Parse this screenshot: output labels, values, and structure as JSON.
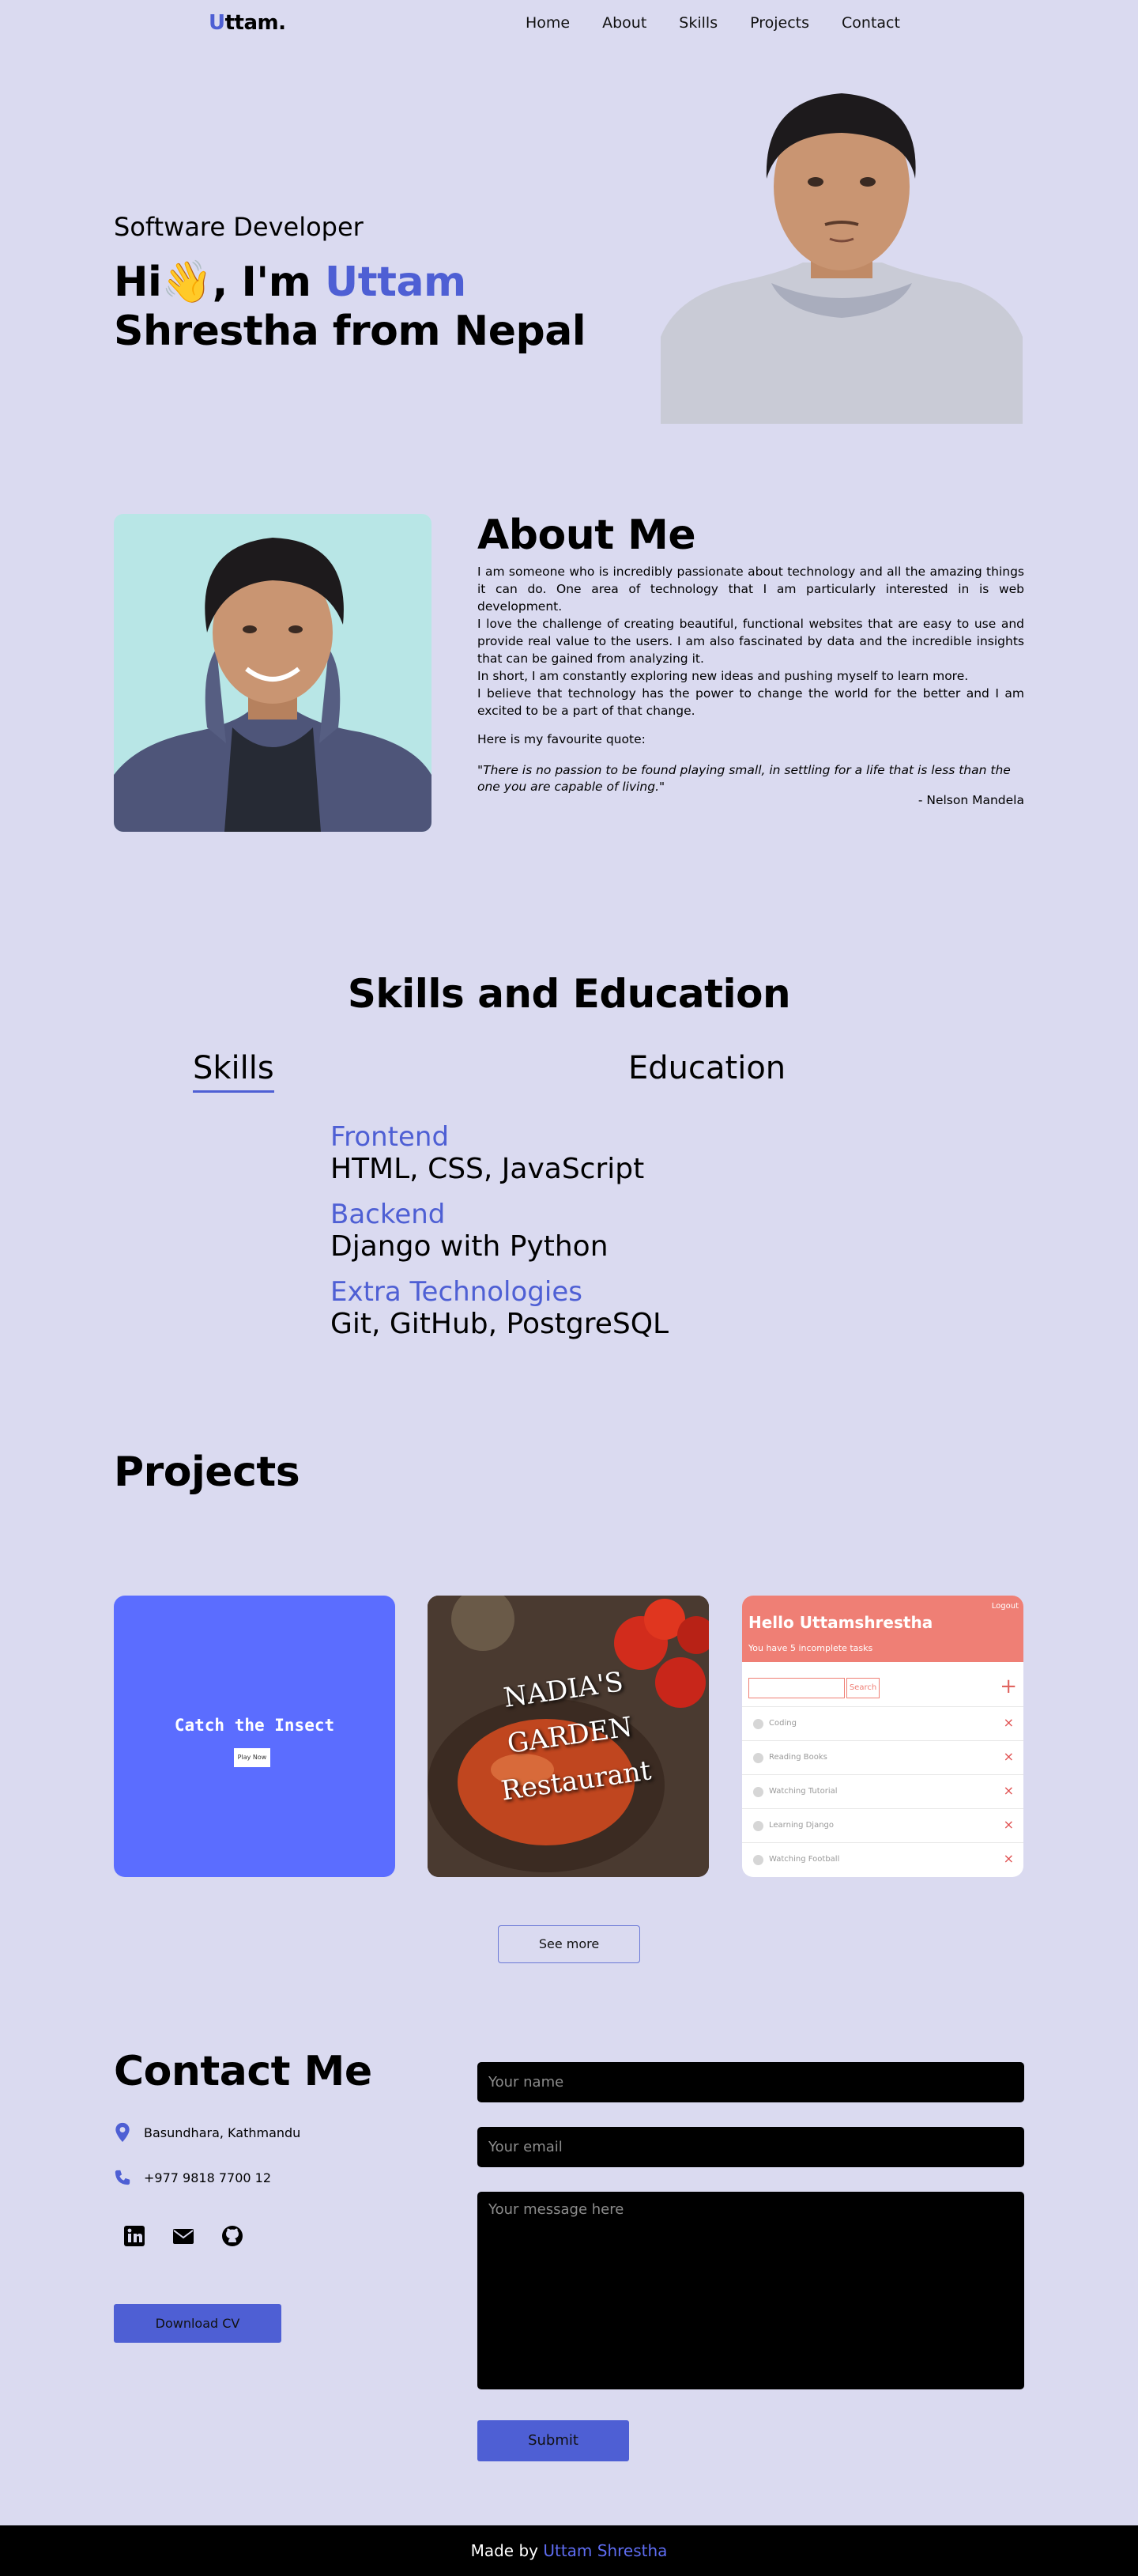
{
  "nav": {
    "brand_first": "U",
    "brand_rest": "ttam.",
    "links": [
      "Home",
      "About",
      "Skills",
      "Projects",
      "Contact"
    ]
  },
  "hero": {
    "subtitle": "Software Developer",
    "title_prefix": "Hi",
    "wave_emoji": "👋",
    "title_mid": ", I'm ",
    "title_name": "Uttam",
    "title_line2": "Shrestha from Nepal"
  },
  "about": {
    "title": "About Me",
    "paragraphs": [
      "I am someone who is incredibly passionate about technology and all the amazing things it can do. One area of technology that I am particularly interested in is web development.",
      "I love the challenge of creating beautiful, functional websites that are easy to use and provide real value to the users. I am also fascinated by data and the incredible insights that can be gained from analyzing it.",
      "In short, I am constantly exploring new ideas and pushing myself to learn more.",
      "I believe that technology has the power to change the world for the better and I am excited to be a part of that change."
    ],
    "quote_intro": "Here is my favourite quote:",
    "quote": "\"There is no passion to be found playing small, in settling for a life that is less than the one you are capable of living.\"",
    "quote_author": "- Nelson Mandela"
  },
  "skills": {
    "title": "Skills and Education",
    "tabs": [
      "Skills",
      "Education"
    ],
    "items": [
      {
        "category": "Frontend",
        "value": "HTML, CSS, JavaScript"
      },
      {
        "category": "Backend",
        "value": "Django with Python"
      },
      {
        "category": "Extra Technologies",
        "value": "Git, GitHub, PostgreSQL"
      }
    ]
  },
  "projects": {
    "title": "Projects",
    "card1": {
      "title": "Catch the Insect",
      "button": "Play Now"
    },
    "card2": {
      "line1": "NADIA'S GARDEN",
      "line2": "Restaurant"
    },
    "card3": {
      "logout": "Logout",
      "hello": "Hello Uttamshrestha",
      "subtitle": "You have 5 incomplete tasks",
      "search": "Search",
      "plus": "+",
      "tasks": [
        "Coding",
        "Reading Books",
        "Watching Tutorial",
        "Learning Django",
        "Watching Football"
      ]
    },
    "see_more": "See more"
  },
  "contact": {
    "title": "Contact Me",
    "address": "Basundhara, Kathmandu",
    "phone": "+977 9818 7700 12",
    "download_cv": "Download CV",
    "name_placeholder": "Your name",
    "email_placeholder": "Your email",
    "message_placeholder": "Your message here",
    "submit": "Submit"
  },
  "footer": {
    "prefix": "Made by ",
    "name": "Uttam Shrestha"
  },
  "colors": {
    "background": "#dadaf0",
    "accent": "#4e5fd4",
    "footer_bg": "#000000"
  }
}
